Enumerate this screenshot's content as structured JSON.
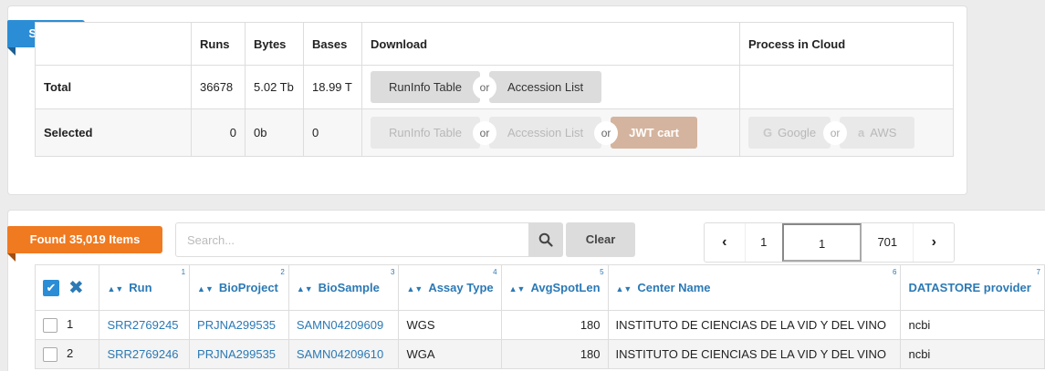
{
  "select_panel": {
    "ribbon": "Select",
    "headers": [
      "Runs",
      "Bytes",
      "Bases",
      "Download",
      "Process in Cloud"
    ],
    "total": {
      "label": "Total",
      "runs": "36678",
      "bytes": "5.02 Tb",
      "bases": "18.99 T"
    },
    "selected": {
      "label": "Selected",
      "runs": "0",
      "bytes": "0b",
      "bases": "0"
    },
    "download": {
      "runinfo": "RunInfo Table",
      "or": "or",
      "accession": "Accession List",
      "jwt": "JWT cart"
    },
    "cloud": {
      "google": "Google",
      "aws": "AWS"
    }
  },
  "found_panel": {
    "ribbon": "Found 35,019 Items",
    "search_placeholder": "Search...",
    "search_value": "",
    "clear_label": "Clear"
  },
  "pager": {
    "prev": "‹",
    "first": "1",
    "current": "1",
    "last": "701",
    "next": "›"
  },
  "results": {
    "columns": [
      {
        "label": "Run",
        "num": "1"
      },
      {
        "label": "BioProject",
        "num": "2"
      },
      {
        "label": "BioSample",
        "num": "3"
      },
      {
        "label": "Assay Type",
        "num": "4"
      },
      {
        "label": "AvgSpotLen",
        "num": "5"
      },
      {
        "label": "Center Name",
        "num": "6"
      },
      {
        "label": "DATASTORE provider",
        "num": "7"
      }
    ],
    "rows": [
      {
        "idx": "1",
        "run": "SRR2769245",
        "bioproject": "PRJNA299535",
        "biosample": "SAMN04209609",
        "assay": "WGS",
        "avgspotlen": "180",
        "center": "INSTITUTO DE CIENCIAS DE LA VID Y DEL VINO",
        "datastore": "ncbi"
      },
      {
        "idx": "2",
        "run": "SRR2769246",
        "bioproject": "PRJNA299535",
        "biosample": "SAMN04209610",
        "assay": "WGA",
        "avgspotlen": "180",
        "center": "INSTITUTO DE CIENCIAS DE LA VID Y DEL VINO",
        "datastore": "ncbi"
      }
    ]
  },
  "colors": {
    "accent_blue": "#2b8dd6",
    "accent_orange": "#f07a20",
    "link": "#2b79b5"
  }
}
